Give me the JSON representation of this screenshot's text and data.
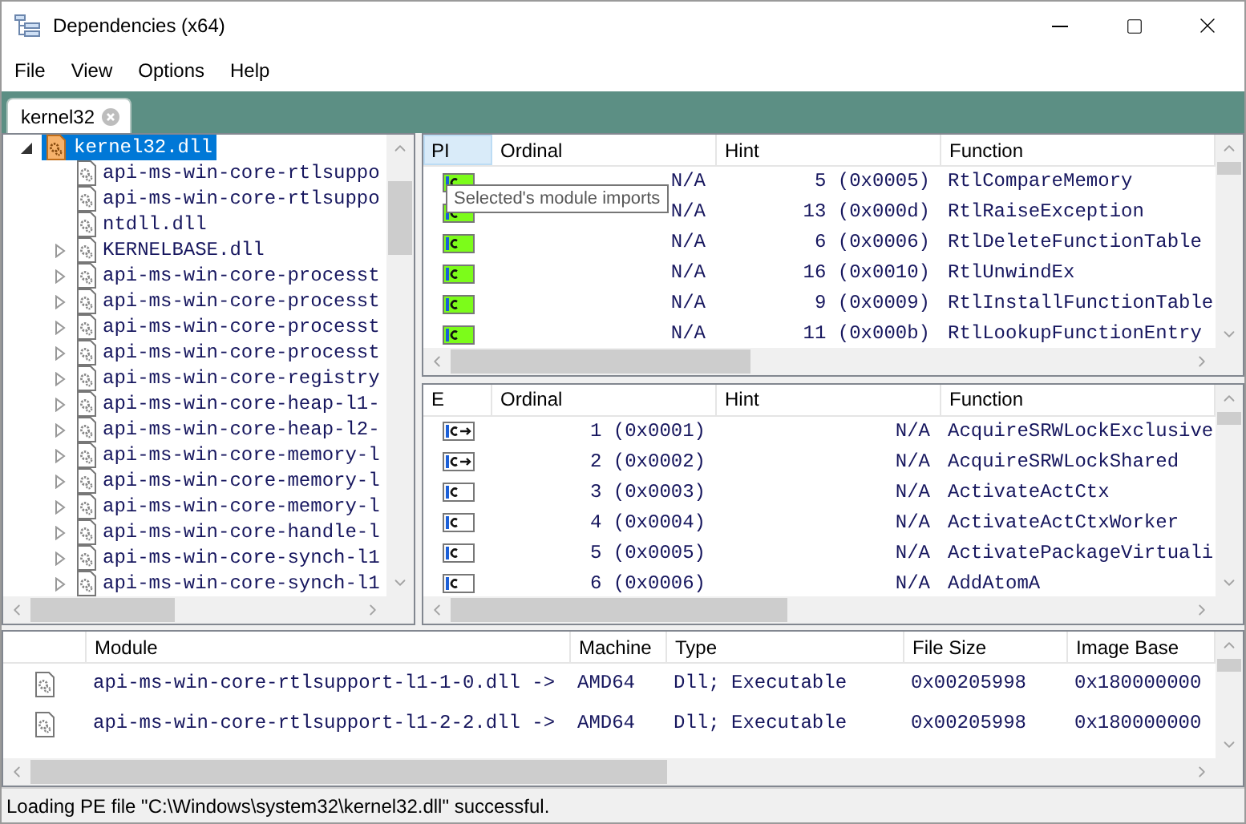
{
  "window": {
    "title": "Dependencies (x64)"
  },
  "menu": [
    "File",
    "View",
    "Options",
    "Help"
  ],
  "tabs": [
    {
      "label": "kernel32",
      "selected": true
    }
  ],
  "module_tree": {
    "items": [
      {
        "label": "kernel32.dll",
        "selected": true,
        "expanded": true,
        "children": [
          {
            "label": "api-ms-win-core-rtlsuppo",
            "selected": false,
            "expandable": false
          },
          {
            "label": "api-ms-win-core-rtlsuppo",
            "selected": false,
            "expandable": false
          },
          {
            "label": "ntdll.dll",
            "selected": false,
            "expandable": false
          },
          {
            "label": "KERNELBASE.dll",
            "selected": false,
            "expandable": true
          },
          {
            "label": "api-ms-win-core-processt",
            "selected": false,
            "expandable": true
          },
          {
            "label": "api-ms-win-core-processt",
            "selected": false,
            "expandable": true
          },
          {
            "label": "api-ms-win-core-processt",
            "selected": false,
            "expandable": true
          },
          {
            "label": "api-ms-win-core-processt",
            "selected": false,
            "expandable": true
          },
          {
            "label": "api-ms-win-core-registry",
            "selected": false,
            "expandable": true
          },
          {
            "label": "api-ms-win-core-heap-l1-",
            "selected": false,
            "expandable": true
          },
          {
            "label": "api-ms-win-core-heap-l2-",
            "selected": false,
            "expandable": true
          },
          {
            "label": "api-ms-win-core-memory-l",
            "selected": false,
            "expandable": true
          },
          {
            "label": "api-ms-win-core-memory-l",
            "selected": false,
            "expandable": true
          },
          {
            "label": "api-ms-win-core-memory-l",
            "selected": false,
            "expandable": true
          },
          {
            "label": "api-ms-win-core-handle-l",
            "selected": false,
            "expandable": true
          },
          {
            "label": "api-ms-win-core-synch-l1",
            "selected": false,
            "expandable": true
          },
          {
            "label": "api-ms-win-core-synch-l1",
            "selected": false,
            "expandable": true
          }
        ]
      }
    ]
  },
  "imports": {
    "columns": [
      {
        "label": "PI",
        "hovered": true
      },
      {
        "label": "Ordinal",
        "hovered": false
      },
      {
        "label": "Hint",
        "hovered": false
      },
      {
        "label": "Function",
        "hovered": false
      }
    ],
    "rows": [
      {
        "ordinal": "N/A",
        "hint": "5 (0x0005)",
        "function": "RtlCompareMemory"
      },
      {
        "ordinal": "N/A",
        "hint": "13 (0x000d)",
        "function": "RtlRaiseException"
      },
      {
        "ordinal": "N/A",
        "hint": "6 (0x0006)",
        "function": "RtlDeleteFunctionTable"
      },
      {
        "ordinal": "N/A",
        "hint": "16 (0x0010)",
        "function": "RtlUnwindEx"
      },
      {
        "ordinal": "N/A",
        "hint": "9 (0x0009)",
        "function": "RtlInstallFunctionTable"
      },
      {
        "ordinal": "N/A",
        "hint": "11 (0x000b)",
        "function": "RtlLookupFunctionEntry"
      }
    ],
    "tooltip": "Selected's module imports"
  },
  "exports": {
    "columns": [
      {
        "label": "E",
        "hovered": false
      },
      {
        "label": "Ordinal",
        "hovered": false
      },
      {
        "label": "Hint",
        "hovered": false
      },
      {
        "label": "Function",
        "hovered": false
      }
    ],
    "rows": [
      {
        "kind": "forward",
        "ordinal": "1 (0x0001)",
        "hint": "N/A",
        "function": "AcquireSRWLockExclusive"
      },
      {
        "kind": "forward",
        "ordinal": "2 (0x0002)",
        "hint": "N/A",
        "function": "AcquireSRWLockShared"
      },
      {
        "kind": "plain",
        "ordinal": "3 (0x0003)",
        "hint": "N/A",
        "function": "ActivateActCtx"
      },
      {
        "kind": "plain",
        "ordinal": "4 (0x0004)",
        "hint": "N/A",
        "function": "ActivateActCtxWorker"
      },
      {
        "kind": "plain",
        "ordinal": "5 (0x0005)",
        "hint": "N/A",
        "function": "ActivatePackageVirtuali"
      },
      {
        "kind": "plain",
        "ordinal": "6 (0x0006)",
        "hint": "N/A",
        "function": "AddAtomA"
      }
    ]
  },
  "modules": {
    "columns": [
      "Module",
      "Machine",
      "Type",
      "File Size",
      "Image Base"
    ],
    "rows": [
      {
        "module": "api-ms-win-core-rtlsupport-l1-1-0.dll ->",
        "machine": "AMD64",
        "type": "Dll; Executable",
        "file_size": "0x00205998",
        "image_base": "0x180000000"
      },
      {
        "module": "api-ms-win-core-rtlsupport-l1-2-2.dll ->",
        "machine": "AMD64",
        "type": "Dll; Executable",
        "file_size": "0x00205998",
        "image_base": "0x180000000"
      }
    ]
  },
  "status_bar": "Loading PE file \"C:\\Windows\\system32\\kernel32.dll\" successful."
}
